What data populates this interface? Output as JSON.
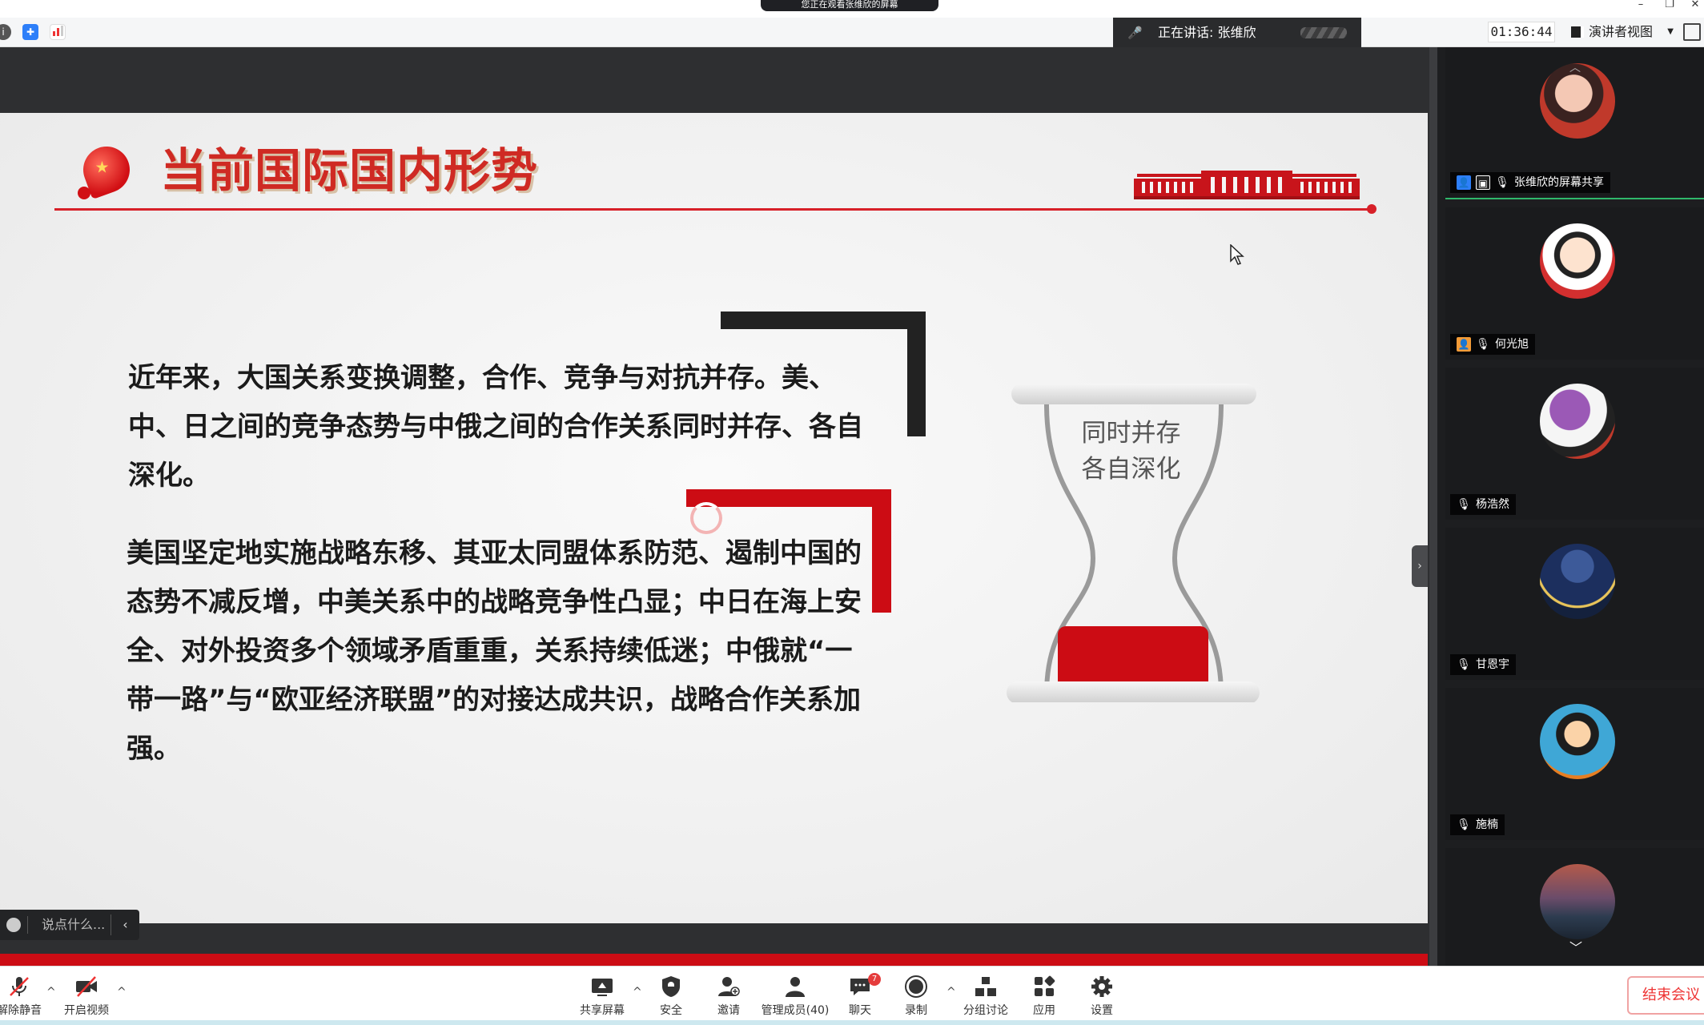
{
  "app": {
    "share_banner": "您正在观看张维欣的屏幕",
    "speaking_label": "正在讲话: 张维欣",
    "timer": "01:36:44",
    "view_mode": "演讲者视图"
  },
  "slide": {
    "title": "当前国际国内形势",
    "paragraph1": "近年来，大国关系变换调整，合作、竞争与对抗并存。美、中、日之间的竞争态势与中俄之间的合作关系同时并存、各自深化。",
    "paragraph2": "美国坚定地实施战略东移、其亚太同盟体系防范、遏制中国的态势不减反增，中美关系中的战略竞争性凸显；中日在海上安全、对外投资多个领域矛盾重重，关系持续低迷；中俄就“一带一路”与“欧亚经济联盟”的对接达成共识，战略合作关系加强。",
    "hourglass_line1": "同时并存",
    "hourglass_line2": "各自深化",
    "accent_color": "#cc0c14"
  },
  "chat": {
    "placeholder": "说点什么..."
  },
  "participants": [
    {
      "name": "张维欣的屏幕共享",
      "avatar_color": "#c0392b"
    },
    {
      "name": "何光旭",
      "avatar_color": "#ffffff"
    },
    {
      "name": "杨浩然",
      "avatar_color": "#7b3f9e"
    },
    {
      "name": "甘恩宇",
      "avatar_color": "#1c2f5e"
    },
    {
      "name": "施楠",
      "avatar_color": "#3fa7d6"
    },
    {
      "name": "",
      "avatar_color": "#b45a4a"
    }
  ],
  "toolbar": {
    "unmute": "解除静音",
    "start_video": "开启视频",
    "share_screen": "共享屏幕",
    "security": "安全",
    "invite": "邀请",
    "manage_members": "管理成员(40)",
    "chat": "聊天",
    "chat_badge": "7",
    "record": "录制",
    "breakout": "分组讨论",
    "apps": "应用",
    "settings": "设置",
    "end_meeting": "结束会议"
  }
}
